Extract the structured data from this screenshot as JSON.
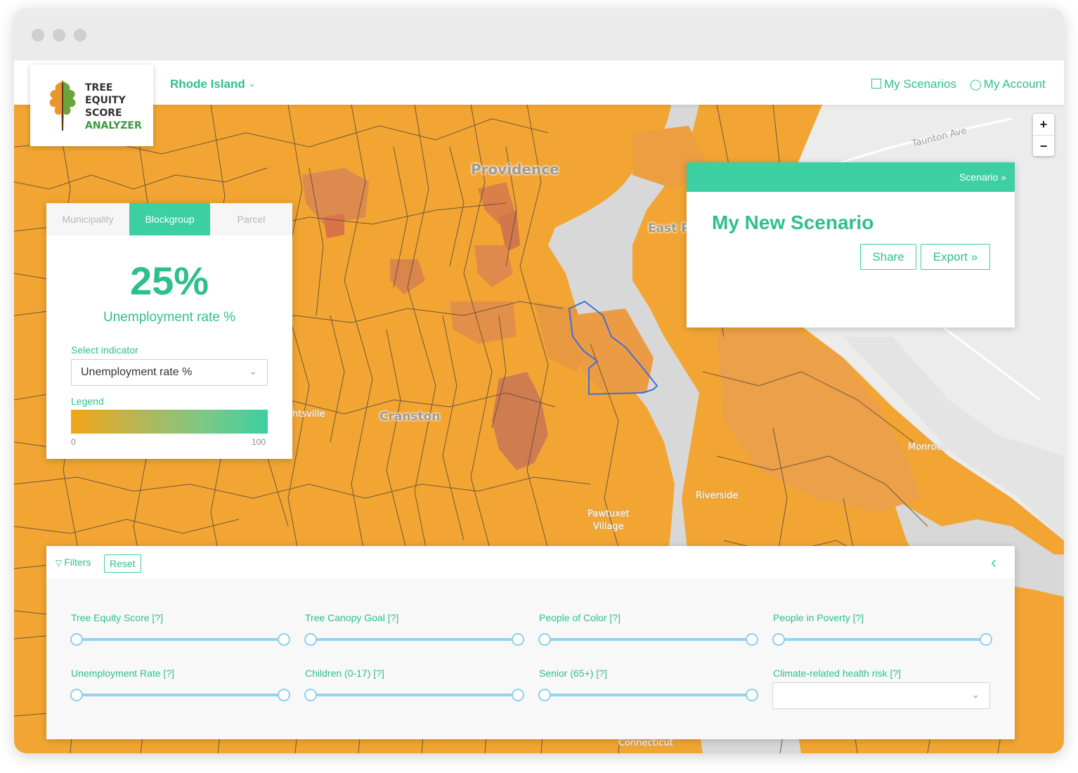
{
  "colors": {
    "accent": "#3ccfa2",
    "accent_text": "#2fbf8f",
    "slider": "#93d5f0",
    "map_low": "#f4a516",
    "map_high": "#cf7d50"
  },
  "header": {
    "logo_lines": [
      "TREE",
      "EQUITY",
      "SCORE",
      "ANALYZER"
    ],
    "state": "Rhode Island",
    "my_scenarios": "My Scenarios",
    "my_account": "My Account"
  },
  "map": {
    "labels": {
      "providence": "Providence",
      "cranston": "Cranston",
      "east_p": "East P",
      "taunton": "Taunton Ave",
      "riverside": "Riverside",
      "pawtuxet": "Pawtuxet",
      "village": "Village",
      "monroes": "Monroes",
      "htsville": "htsville",
      "connecticut": "Connecticut"
    },
    "zoom_in": "+",
    "zoom_out": "−"
  },
  "indicator_panel": {
    "tabs": [
      "Municipality",
      "Blockgroup",
      "Parcel"
    ],
    "active_tab": "Blockgroup",
    "value": "25%",
    "value_label": "Unemployment rate %",
    "select_label": "Select indicator",
    "selected_indicator": "Unemployment rate %",
    "legend_label": "Legend",
    "legend_min": "0",
    "legend_max": "100"
  },
  "scenario_panel": {
    "link": "Scenario »",
    "title": "My New Scenario",
    "share": "Share",
    "export": "Export »"
  },
  "filters": {
    "label": "Filters",
    "reset": "Reset",
    "items": [
      {
        "label": "Tree Equity Score [?]",
        "min": 0,
        "max": 1
      },
      {
        "label": "Tree Canopy Goal [?]",
        "min": 0,
        "max": 1
      },
      {
        "label": "People of Color [?]",
        "min": 0,
        "max": 1
      },
      {
        "label": "People in Poverty [?]",
        "min": 0,
        "max": 1
      },
      {
        "label": "Unemployment Rate [?]",
        "min": 0,
        "max": 1
      },
      {
        "label": "Children (0-17) [?]",
        "min": 0,
        "max": 1
      },
      {
        "label": "Senior (65+) [?]",
        "min": 0,
        "max": 1
      },
      {
        "label": "Climate-related health risk [?]"
      }
    ]
  }
}
